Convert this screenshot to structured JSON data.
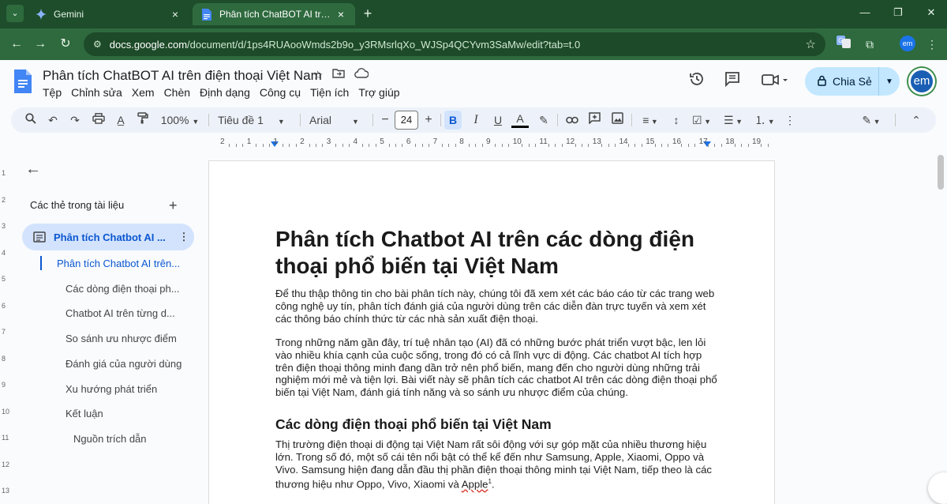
{
  "browser": {
    "tabs": [
      {
        "title": "Gemini",
        "icon": "gemini-sparkle-icon",
        "active": false
      },
      {
        "title": "Phân tích ChatBOT AI trên điện",
        "icon": "docs-icon",
        "active": true
      }
    ],
    "url_prefix": "docs.google.com",
    "url_rest": "/document/d/1ps4RUAooWmds2b9o_y3RMsrlqXo_WJSp4QCYvm3SaMw/edit?tab=t.0",
    "profile_initials": "em",
    "theme_color": "#1e4d2b"
  },
  "docs": {
    "title": "Phân tích ChatBOT AI trên điện thoại Việt Nam",
    "menu": [
      "Tệp",
      "Chỉnh sửa",
      "Xem",
      "Chèn",
      "Định dạng",
      "Công cụ",
      "Tiện ích",
      "Trợ giúp"
    ],
    "share_label": "Chia Sẻ",
    "avatar_initials": "em",
    "accent": "#0b57d0"
  },
  "toolbar": {
    "zoom": "100%",
    "style": "Tiêu đề 1",
    "font": "Arial",
    "font_size": "24",
    "minus": "−",
    "plus": "+"
  },
  "ruler": {
    "numbers": [
      "2",
      "1",
      "1",
      "2",
      "3",
      "4",
      "5",
      "6",
      "7",
      "8",
      "9",
      "10",
      "11",
      "12",
      "13",
      "14",
      "15",
      "16",
      "17",
      "18",
      "19"
    ]
  },
  "vruler": {
    "numbers": [
      "1",
      "2",
      "3",
      "4",
      "5",
      "6",
      "7",
      "8",
      "9",
      "10",
      "11",
      "12",
      "13"
    ]
  },
  "outline": {
    "heading": "Các thẻ trong tài liệu",
    "tab_label": "Phân tích Chatbot AI ...",
    "items": [
      {
        "label": "Phân tích Chatbot AI trên...",
        "level": 1,
        "current": true
      },
      {
        "label": "Các dòng điện thoại ph...",
        "level": 2
      },
      {
        "label": "Chatbot AI trên từng d...",
        "level": 2
      },
      {
        "label": "So sánh ưu nhược điểm",
        "level": 2
      },
      {
        "label": "Đánh giá của người dùng",
        "level": 2
      },
      {
        "label": "Xu hướng phát triển",
        "level": 2
      },
      {
        "label": "Kết luận",
        "level": 2
      },
      {
        "label": "Nguồn trích dẫn",
        "level": 3
      }
    ]
  },
  "page": {
    "h1": "Phân tích Chatbot AI trên các dòng điện thoại phổ biến tại Việt Nam",
    "p1": "Để thu thập thông tin cho bài phân tích này, chúng tôi đã xem xét các báo cáo từ các trang web công nghệ uy tín, phân tích đánh giá của người dùng trên các diễn đàn trực tuyến và xem xét các thông báo chính thức từ các nhà sản xuất điện thoại.",
    "p2": "Trong những năm gần đây, trí tuệ nhân tạo (AI) đã có những bước phát triển vượt bậc, len lỏi vào nhiều khía cạnh của cuộc sống, trong đó có cả lĩnh vực di động. Các chatbot AI tích hợp trên điện thoại thông minh đang dần trở nên phổ biến, mang đến cho người dùng những trải nghiệm mới mẻ và tiện lợi. Bài viết này sẽ phân tích các chatbot AI trên các dòng điện thoại phổ biến tại Việt Nam, đánh giá tính năng và so sánh ưu nhược điểm của chúng.",
    "h2": "Các dòng điện thoại phổ biến tại Việt Nam",
    "p3_main": "Thị trường điện thoại di động tại Việt Nam rất sôi động với sự góp mặt của nhiều thương hiệu lớn. Trong số đó, một số cái tên nổi bật có thể kể đến như Samsung, Apple, Xiaomi, Oppo và Vivo. Samsung hiện đang dẫn đầu thị phần điện thoại thông minh tại Việt Nam, tiếp theo là các thương hiệu như Oppo, Vivo, Xiaomi và ",
    "p3_apple": "Apple",
    "p3_sup": "1",
    "p3_end": "."
  }
}
